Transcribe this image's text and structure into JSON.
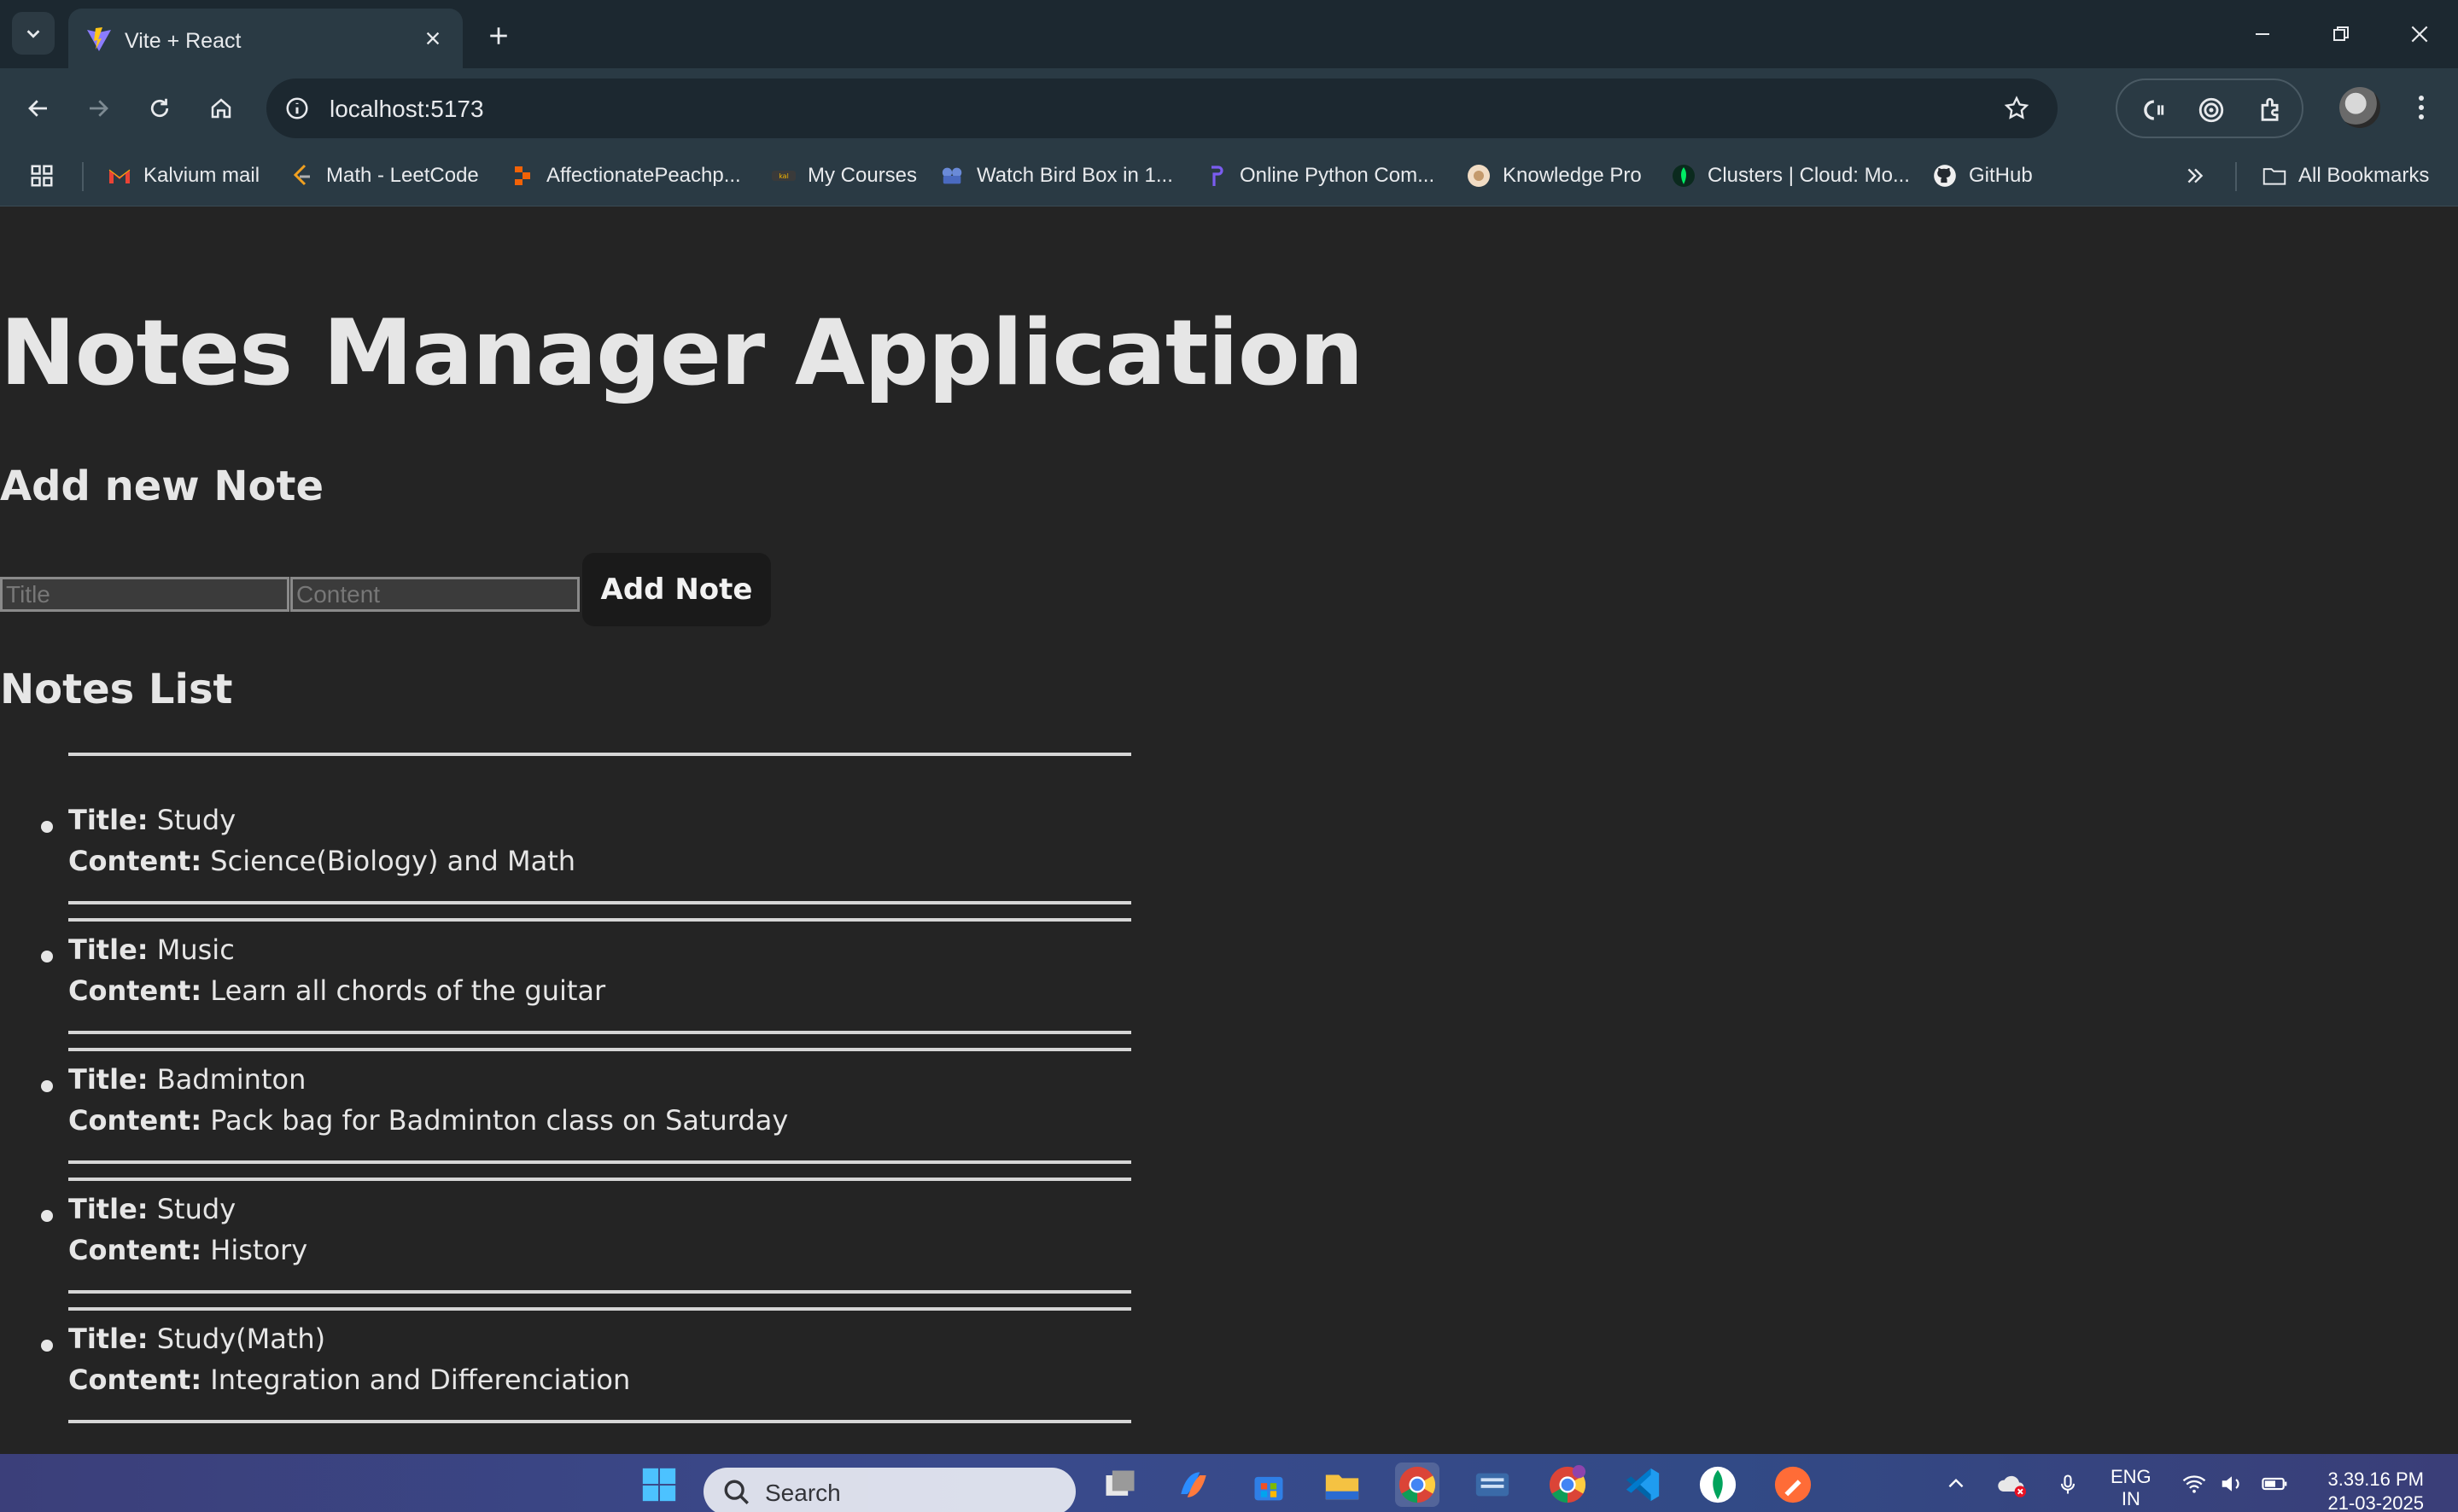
{
  "browser": {
    "tab_title": "Vite + React",
    "url": "localhost:5173",
    "bookmarks": [
      {
        "label": "Kalvium mail",
        "icon": "gmail-icon"
      },
      {
        "label": "Math - LeetCode",
        "icon": "leetcode-icon"
      },
      {
        "label": "AffectionatePeachp...",
        "icon": "replit-icon"
      },
      {
        "label": "My Courses",
        "icon": "courses-icon"
      },
      {
        "label": "Watch Bird Box in 1...",
        "icon": "video-icon"
      },
      {
        "label": "Online Python Com...",
        "icon": "python-icon"
      },
      {
        "label": "Knowledge Pro",
        "icon": "knowledge-icon"
      },
      {
        "label": "Clusters | Cloud: Mo...",
        "icon": "mongodb-icon"
      },
      {
        "label": "GitHub",
        "icon": "github-icon"
      }
    ],
    "all_bookmarks": "All Bookmarks"
  },
  "app": {
    "title": "Notes Manager Application",
    "add_heading": "Add new Note",
    "title_placeholder": "Title",
    "content_placeholder": "Content",
    "add_button": "Add Note",
    "list_heading": "Notes List",
    "title_label": "Title:",
    "content_label": "Content:",
    "notes": [
      {
        "title": "Study",
        "content": "Science(Biology) and Math"
      },
      {
        "title": "Music",
        "content": "Learn all chords of the guitar"
      },
      {
        "title": "Badminton",
        "content": "Pack bag for Badminton class on Saturday"
      },
      {
        "title": "Study",
        "content": "History"
      },
      {
        "title": "Study(Math)",
        "content": "Integration and Differenciation"
      }
    ]
  },
  "taskbar": {
    "search_label": "Search",
    "language": "ENG",
    "region": "IN",
    "time": "3.39.16 PM",
    "date": "21-03-2025"
  }
}
